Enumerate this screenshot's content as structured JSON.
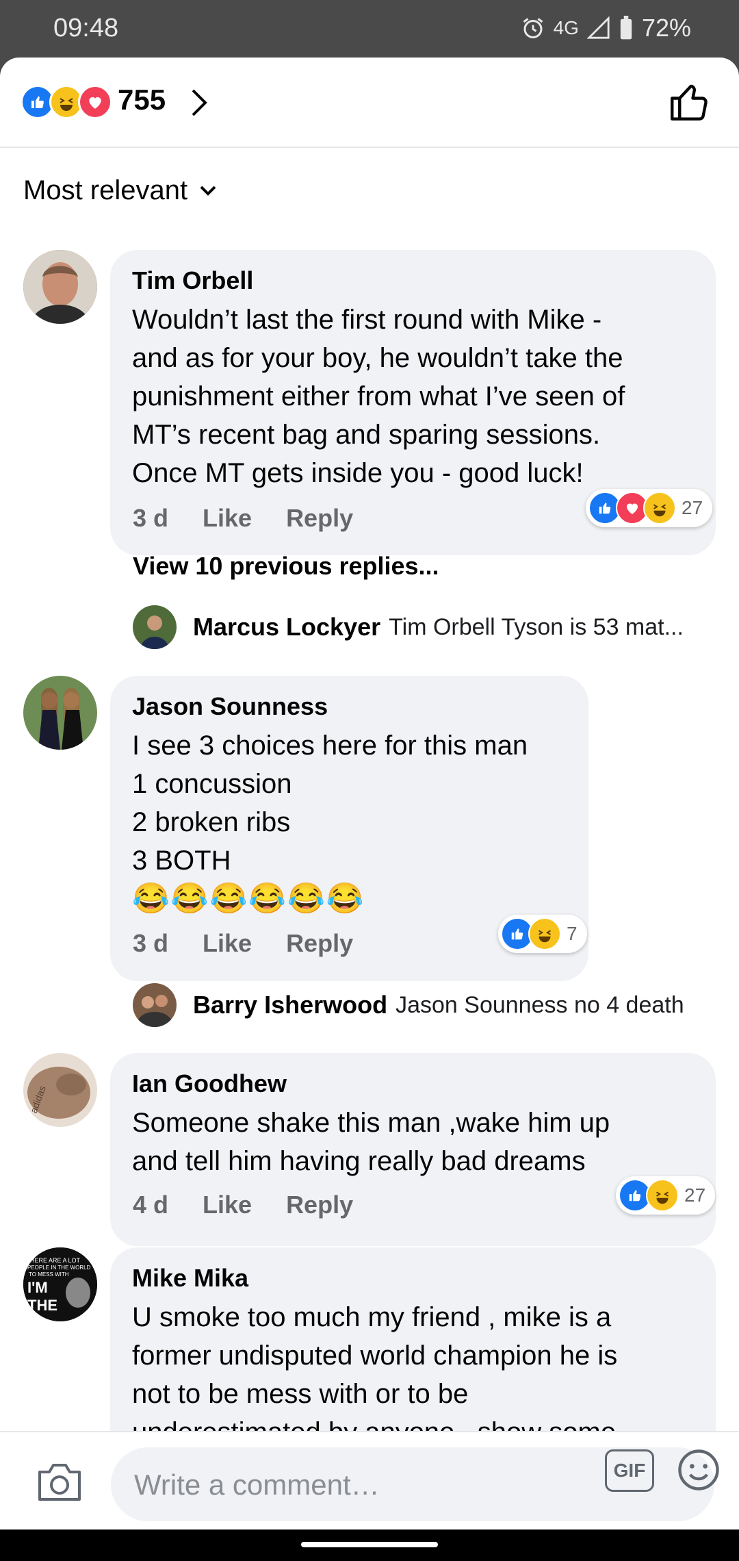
{
  "status_bar": {
    "time": "09:48",
    "network": "4G",
    "battery": "72%"
  },
  "header": {
    "reactions_count": "755",
    "reaction_icons": [
      "like-icon",
      "haha-icon",
      "love-icon"
    ]
  },
  "sort": {
    "label": "Most relevant"
  },
  "comments": [
    {
      "author": "Tim Orbell",
      "lines": [
        "Wouldn’t last the first round with Mike -",
        "and as for your boy, he wouldn’t take the",
        "punishment either from what I’ve seen of",
        "MT’s recent bag and sparing sessions.",
        "Once MT gets inside you - good luck!"
      ],
      "time": "3 d",
      "like": "Like",
      "reply": "Reply",
      "reaction_count": "27"
    },
    {
      "author": "Jason Sounness",
      "lines": [
        "I see 3 choices here for this man",
        "1 concussion",
        "2 broken ribs",
        "3 BOTH"
      ],
      "emoji": "😂😂😂😂😂😂",
      "time": "3 d",
      "like": "Like",
      "reply": "Reply",
      "reaction_count": "7"
    },
    {
      "author": "Ian Goodhew",
      "lines": [
        "Someone shake this man ,wake him up",
        "and tell him having really bad dreams"
      ],
      "time": "4 d",
      "like": "Like",
      "reply": "Reply",
      "reaction_count": "27"
    },
    {
      "author": "Mike Mika",
      "lines": [
        "U smoke too much my friend , mike is a",
        "former undisputed world champion he is",
        "not to be mess with or to be",
        "underestimated by anyone , show some"
      ]
    }
  ],
  "view_previous": "View 10 previous replies...",
  "replies": [
    {
      "author": "Marcus Lockyer",
      "text": "Tim Orbell Tyson is 53 mat..."
    },
    {
      "author": "Barry Isherwood",
      "text": "Jason Sounness no 4 death"
    }
  ],
  "avatar_texts": {
    "mike_mika": [
      "HERE ARE A LOT",
      "PEOPLE IN THE WORLD",
      "TO MESS WITH",
      "I'M",
      "THE"
    ],
    "ian_goodhew": "adidas"
  },
  "composer": {
    "placeholder": "Write a comment…",
    "gif_label": "GIF"
  },
  "colors": {
    "accent": "#1877f2",
    "bubble": "#f0f2f5",
    "muted": "#65676b"
  }
}
